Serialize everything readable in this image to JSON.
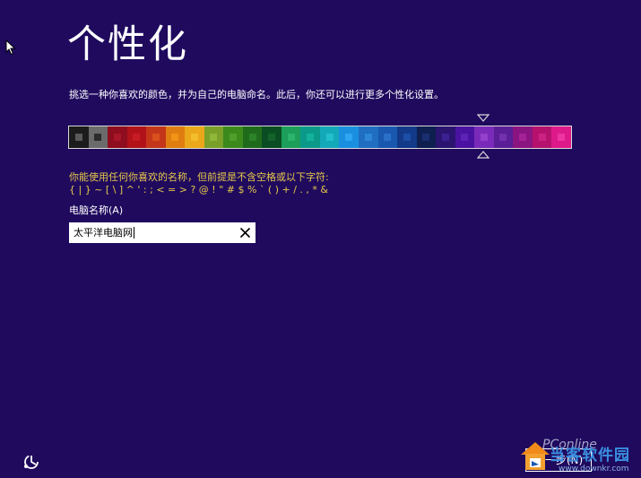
{
  "page": {
    "title": "个性化",
    "description": "挑选一种你喜欢的颜色，并为自己的电脑命名。此后，你还可以进行更多个性化设置。"
  },
  "colors": {
    "background": "#1f0a5e",
    "hint_text": "#e6c84a"
  },
  "color_picker": {
    "selected_index": 21,
    "swatches": [
      {
        "bg": "#1c1c1c",
        "mark": "#5a5a5a"
      },
      {
        "bg": "#6b6b6b",
        "mark": "#2b2b2b"
      },
      {
        "bg": "#8e0d1e",
        "mark": "#a8162a"
      },
      {
        "bg": "#b2121a",
        "mark": "#c71c24"
      },
      {
        "bg": "#c4361a",
        "mark": "#d9501e"
      },
      {
        "bg": "#e07d10",
        "mark": "#f09416"
      },
      {
        "bg": "#eaa81a",
        "mark": "#f4be2a"
      },
      {
        "bg": "#7ba02a",
        "mark": "#8fb838"
      },
      {
        "bg": "#3c8a1c",
        "mark": "#4fa02a"
      },
      {
        "bg": "#1f6b1c",
        "mark": "#2c8328"
      },
      {
        "bg": "#0b4d22",
        "mark": "#14632c"
      },
      {
        "bg": "#1d9e5a",
        "mark": "#2db46c"
      },
      {
        "bg": "#0b9a8a",
        "mark": "#14b29e"
      },
      {
        "bg": "#14a9b8",
        "mark": "#22c0cc"
      },
      {
        "bg": "#1a8fe0",
        "mark": "#2fa6f2"
      },
      {
        "bg": "#1f6ec2",
        "mark": "#2f86d8"
      },
      {
        "bg": "#1a58b0",
        "mark": "#2a70c8"
      },
      {
        "bg": "#123a88",
        "mark": "#1c4ea6"
      },
      {
        "bg": "#0e1f50",
        "mark": "#1a2f70"
      },
      {
        "bg": "#2a1470",
        "mark": "#3a2090"
      },
      {
        "bg": "#4a12a0",
        "mark": "#5e22b8"
      },
      {
        "bg": "#7a2ab8",
        "mark": "#9440cc"
      },
      {
        "bg": "#5a1e96",
        "mark": "#7230ae"
      },
      {
        "bg": "#8a1480",
        "mark": "#a42298"
      },
      {
        "bg": "#b5126e",
        "mark": "#cc2284"
      },
      {
        "bg": "#de1a8a",
        "mark": "#ee34a0"
      }
    ]
  },
  "naming": {
    "hint_line1": "你能使用任何你喜欢的名称，但前提是不含空格或以下字符:",
    "hint_line2": "{ | } ~ [ \\ ] ^ ' : ; < = > ? @ ! \" # $ % ` ( ) + / . , * &",
    "label": "电脑名称(A)",
    "value": "太平洋电脑网"
  },
  "footer": {
    "next_button": "下一步(N)",
    "accessibility_icon": "ease-of-access-icon",
    "watermark": {
      "pc": "PConline",
      "site": "当客软件园",
      "url": "www.downkr.com"
    }
  }
}
